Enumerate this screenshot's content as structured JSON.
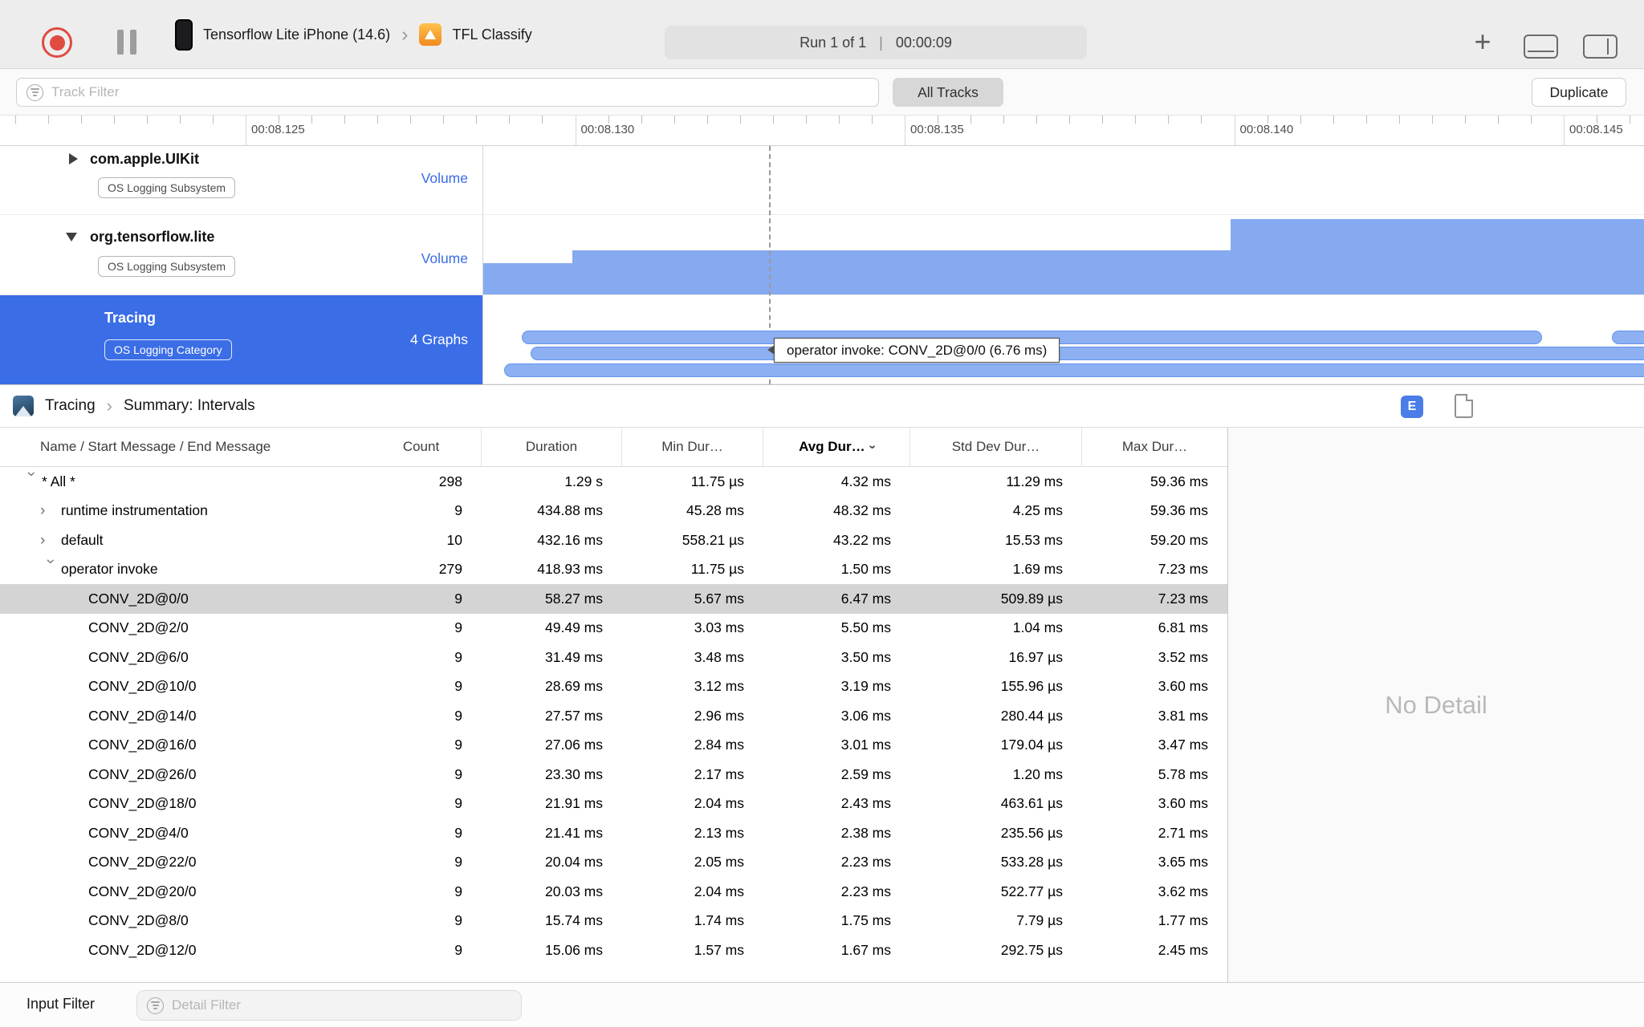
{
  "toolbar": {
    "device": "Tensorflow Lite iPhone (14.6)",
    "target": "TFL Classify",
    "run_progress": "Run 1 of 1",
    "run_separator": "|",
    "run_time": "00:00:09",
    "add_button": "+"
  },
  "filter_row": {
    "track_filter_placeholder": "Track Filter",
    "all_tracks_label": "All Tracks",
    "duplicate_label": "Duplicate"
  },
  "timeline": {
    "labels": [
      "00:08.125",
      "00:08.130",
      "00:08.135",
      "00:08.140",
      "00:08.145"
    ]
  },
  "tracks": [
    {
      "name": "com.apple.UIKit",
      "badge": "OS Logging Subsystem",
      "side_label": "Volume",
      "disclosure": "collapsed"
    },
    {
      "name": "org.tensorflow.lite",
      "badge": "OS Logging Subsystem",
      "side_label": "Volume",
      "disclosure": "expanded",
      "graph_steps": [
        {
          "from": 0.0,
          "to": 0.077,
          "level": 0.39
        },
        {
          "from": 0.077,
          "to": 0.644,
          "level": 0.56
        },
        {
          "from": 0.644,
          "to": 1.0,
          "level": 0.95
        }
      ]
    },
    {
      "name": "Tracing",
      "badge": "OS Logging Category",
      "side_label": "4 Graphs",
      "selected": true,
      "intervals": [
        {
          "lane": 0,
          "from": 0.033,
          "to": 0.912
        },
        {
          "lane": 0,
          "from": 0.972,
          "to": 1.01
        },
        {
          "lane": 1,
          "from": 0.041,
          "to": 1.01
        },
        {
          "lane": 2,
          "from": 0.018,
          "to": 1.01
        }
      ]
    }
  ],
  "tooltip": "operator invoke: CONV_2D@0/0 (6.76 ms)",
  "breadcrumb": [
    "Tracing",
    "Summary: Intervals"
  ],
  "detail_header": {
    "e_button": "E"
  },
  "table": {
    "columns": [
      {
        "key": "name",
        "label": "Name / Start Message / End Message"
      },
      {
        "key": "count",
        "label": "Count"
      },
      {
        "key": "duration",
        "label": "Duration"
      },
      {
        "key": "min",
        "label": "Min Dur…"
      },
      {
        "key": "avg",
        "label": "Avg Dur…",
        "sorted": true
      },
      {
        "key": "stddev",
        "label": "Std Dev Dur…"
      },
      {
        "key": "max",
        "label": "Max Dur…"
      }
    ],
    "rows": [
      {
        "indent": 0,
        "chevron": "down",
        "name": "* All *",
        "count": "298",
        "duration": "1.29 s",
        "min": "11.75 µs",
        "avg": "4.32 ms",
        "std": "11.29 ms",
        "max": "59.36 ms"
      },
      {
        "indent": 1,
        "chevron": "right",
        "name": "runtime instrumentation",
        "count": "9",
        "duration": "434.88 ms",
        "min": "45.28 ms",
        "avg": "48.32 ms",
        "std": "4.25 ms",
        "max": "59.36 ms"
      },
      {
        "indent": 1,
        "chevron": "right",
        "name": "default",
        "count": "10",
        "duration": "432.16 ms",
        "min": "558.21 µs",
        "avg": "43.22 ms",
        "std": "15.53 ms",
        "max": "59.20 ms"
      },
      {
        "indent": 1,
        "chevron": "down",
        "name": "operator invoke",
        "count": "279",
        "duration": "418.93 ms",
        "min": "11.75 µs",
        "avg": "1.50 ms",
        "std": "1.69 ms",
        "max": "7.23 ms"
      },
      {
        "indent": 2,
        "selected": true,
        "name": "CONV_2D@0/0",
        "count": "9",
        "duration": "58.27 ms",
        "min": "5.67 ms",
        "avg": "6.47 ms",
        "std": "509.89 µs",
        "max": "7.23 ms"
      },
      {
        "indent": 2,
        "name": "CONV_2D@2/0",
        "count": "9",
        "duration": "49.49 ms",
        "min": "3.03 ms",
        "avg": "5.50 ms",
        "std": "1.04 ms",
        "max": "6.81 ms"
      },
      {
        "indent": 2,
        "name": "CONV_2D@6/0",
        "count": "9",
        "duration": "31.49 ms",
        "min": "3.48 ms",
        "avg": "3.50 ms",
        "std": "16.97 µs",
        "max": "3.52 ms"
      },
      {
        "indent": 2,
        "name": "CONV_2D@10/0",
        "count": "9",
        "duration": "28.69 ms",
        "min": "3.12 ms",
        "avg": "3.19 ms",
        "std": "155.96 µs",
        "max": "3.60 ms"
      },
      {
        "indent": 2,
        "name": "CONV_2D@14/0",
        "count": "9",
        "duration": "27.57 ms",
        "min": "2.96 ms",
        "avg": "3.06 ms",
        "std": "280.44 µs",
        "max": "3.81 ms"
      },
      {
        "indent": 2,
        "name": "CONV_2D@16/0",
        "count": "9",
        "duration": "27.06 ms",
        "min": "2.84 ms",
        "avg": "3.01 ms",
        "std": "179.04 µs",
        "max": "3.47 ms"
      },
      {
        "indent": 2,
        "name": "CONV_2D@26/0",
        "count": "9",
        "duration": "23.30 ms",
        "min": "2.17 ms",
        "avg": "2.59 ms",
        "std": "1.20 ms",
        "max": "5.78 ms"
      },
      {
        "indent": 2,
        "name": "CONV_2D@18/0",
        "count": "9",
        "duration": "21.91 ms",
        "min": "2.04 ms",
        "avg": "2.43 ms",
        "std": "463.61 µs",
        "max": "3.60 ms"
      },
      {
        "indent": 2,
        "name": "CONV_2D@4/0",
        "count": "9",
        "duration": "21.41 ms",
        "min": "2.13 ms",
        "avg": "2.38 ms",
        "std": "235.56 µs",
        "max": "2.71 ms"
      },
      {
        "indent": 2,
        "name": "CONV_2D@22/0",
        "count": "9",
        "duration": "20.04 ms",
        "min": "2.05 ms",
        "avg": "2.23 ms",
        "std": "533.28 µs",
        "max": "3.65 ms"
      },
      {
        "indent": 2,
        "name": "CONV_2D@20/0",
        "count": "9",
        "duration": "20.03 ms",
        "min": "2.04 ms",
        "avg": "2.23 ms",
        "std": "522.77 µs",
        "max": "3.62 ms"
      },
      {
        "indent": 2,
        "name": "CONV_2D@8/0",
        "count": "9",
        "duration": "15.74 ms",
        "min": "1.74 ms",
        "avg": "1.75 ms",
        "std": "7.79 µs",
        "max": "1.77 ms"
      },
      {
        "indent": 2,
        "name": "CONV_2D@12/0",
        "count": "9",
        "duration": "15.06 ms",
        "min": "1.57 ms",
        "avg": "1.67 ms",
        "std": "292.75 µs",
        "max": "2.45 ms"
      }
    ]
  },
  "detail_pane": {
    "empty_text": "No Detail"
  },
  "bottom_bar": {
    "input_filter_label": "Input Filter",
    "detail_filter_placeholder": "Detail Filter"
  },
  "colors": {
    "selection_blue": "#3a6de6",
    "graph_blue": "#86aaf0",
    "interval_blue": "#8db0f3",
    "volume_label_blue": "#3b6ce5",
    "selected_row_gray": "#d4d4d4",
    "record_red": "#df4a41",
    "e_button_blue": "#4a7de8"
  }
}
